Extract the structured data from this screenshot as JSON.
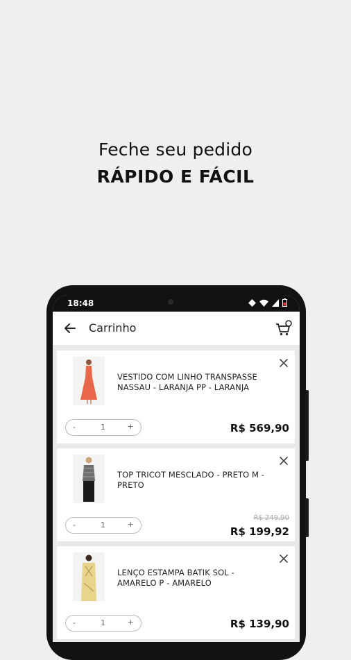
{
  "promo": {
    "line1": "Feche seu pedido",
    "line2": "RÁPIDO E FÁCIL"
  },
  "status_bar": {
    "time": "18:48"
  },
  "app_bar": {
    "title": "Carrinho",
    "back_icon": "arrow-left-icon",
    "cart_icon": "cart-icon"
  },
  "cart": {
    "items": [
      {
        "name": "VESTIDO COM LINHO TRANSPASSE NASSAU - LARANJA PP - LARANJA",
        "quantity": "1",
        "minus": "-",
        "plus": "+",
        "price": "R$ 569,90",
        "old_price": ""
      },
      {
        "name": "TOP TRICOT MESCLADO - PRETO M - PRETO",
        "quantity": "1",
        "minus": "-",
        "plus": "+",
        "price": "R$ 199,92",
        "old_price": "R$ 249,90"
      },
      {
        "name": "LENÇO ESTAMPA BATIK SOL - AMARELO P - AMARELO",
        "quantity": "1",
        "minus": "-",
        "plus": "+",
        "price": "R$ 139,90",
        "old_price": ""
      }
    ]
  },
  "colors": {
    "background": "#efefef",
    "phone": "#121212",
    "dress": "#e8674a",
    "scarf": "#e8d48a"
  }
}
